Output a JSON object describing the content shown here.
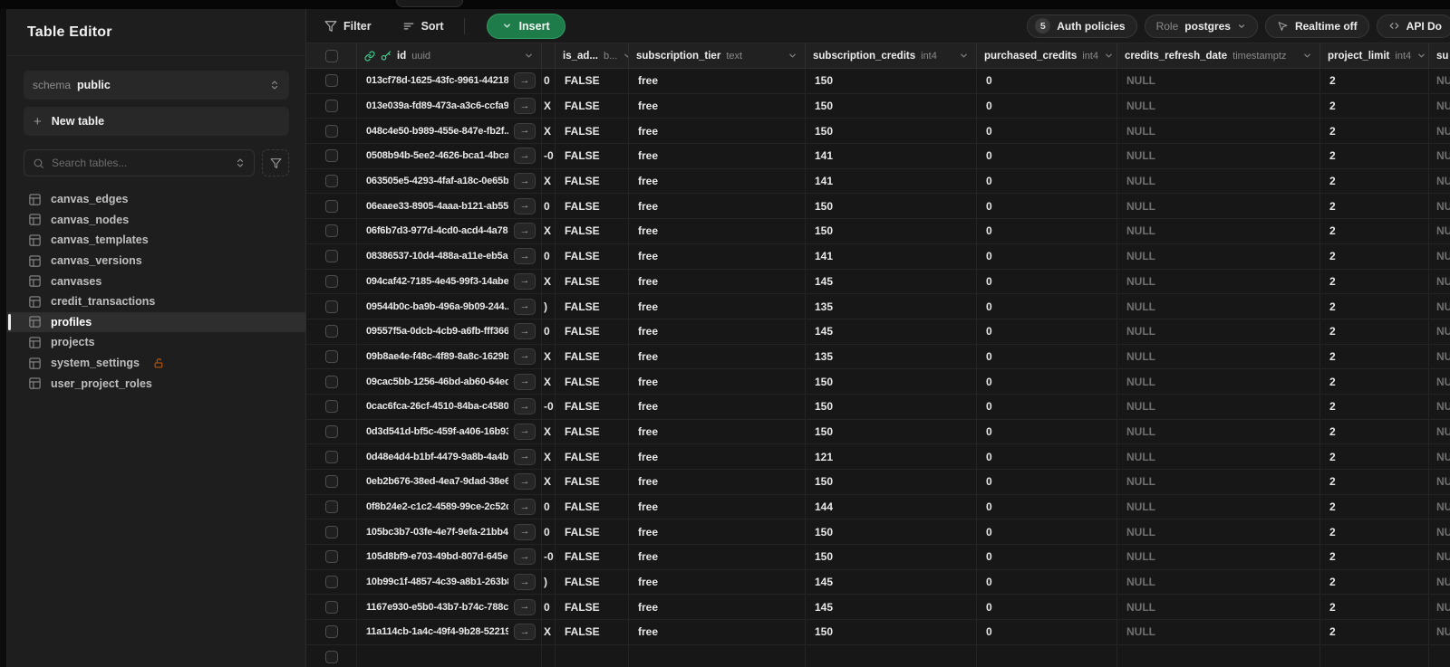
{
  "palette": {
    "accent_green": "#3ecf8e",
    "insert_button_green": "#1d7c4a",
    "lock_amber": "#b45309",
    "null_text_gray": "#707070"
  },
  "sidebar": {
    "title": "Table Editor",
    "schema_label": "schema",
    "schema_value": "public",
    "new_table_label": "New table",
    "search_placeholder": "Search tables...",
    "tables": [
      {
        "label": "canvas_edges",
        "selected": false,
        "locked": false
      },
      {
        "label": "canvas_nodes",
        "selected": false,
        "locked": false
      },
      {
        "label": "canvas_templates",
        "selected": false,
        "locked": false
      },
      {
        "label": "canvas_versions",
        "selected": false,
        "locked": false
      },
      {
        "label": "canvases",
        "selected": false,
        "locked": false
      },
      {
        "label": "credit_transactions",
        "selected": false,
        "locked": false
      },
      {
        "label": "profiles",
        "selected": true,
        "locked": false
      },
      {
        "label": "projects",
        "selected": false,
        "locked": false
      },
      {
        "label": "system_settings",
        "selected": false,
        "locked": true
      },
      {
        "label": "user_project_roles",
        "selected": false,
        "locked": false
      }
    ]
  },
  "toolbar": {
    "filter_label": "Filter",
    "sort_label": "Sort",
    "insert_label": "Insert",
    "auth_policies_count": "5",
    "auth_policies_label": "Auth policies",
    "role_prefix": "Role",
    "role_value": "postgres",
    "realtime_label": "Realtime off",
    "api_docs_label": "API Do"
  },
  "grid": {
    "columns": [
      {
        "name": "id",
        "type": "uuid"
      },
      {
        "name": "",
        "type": ""
      },
      {
        "name": "is_ad...",
        "type": "b..."
      },
      {
        "name": "subscription_tier",
        "type": "text"
      },
      {
        "name": "subscription_credits",
        "type": "int4"
      },
      {
        "name": "purchased_credits",
        "type": "int4"
      },
      {
        "name": "credits_refresh_date",
        "type": "timestamptz"
      },
      {
        "name": "project_limit",
        "type": "int4"
      },
      {
        "name": "su",
        "type": ""
      }
    ],
    "expand_glyph": "→",
    "rows": [
      {
        "id": "013cf78d-1625-43fc-9961-442189...",
        "frag": "0",
        "is_admin": "FALSE",
        "tier": "free",
        "sub_credits": "150",
        "purchased": "0",
        "refresh": "NULL",
        "limit": "2",
        "last": "NULL"
      },
      {
        "id": "013e039a-fd89-473a-a3c6-ccfa9...",
        "frag": "X",
        "is_admin": "FALSE",
        "tier": "free",
        "sub_credits": "150",
        "purchased": "0",
        "refresh": "NULL",
        "limit": "2",
        "last": "NULL"
      },
      {
        "id": "048c4e50-b989-455e-847e-fb2f...",
        "frag": "X",
        "is_admin": "FALSE",
        "tier": "free",
        "sub_credits": "150",
        "purchased": "0",
        "refresh": "NULL",
        "limit": "2",
        "last": "NULL"
      },
      {
        "id": "0508b94b-5ee2-4626-bca1-4bca...",
        "frag": "-0",
        "is_admin": "FALSE",
        "tier": "free",
        "sub_credits": "141",
        "purchased": "0",
        "refresh": "NULL",
        "limit": "2",
        "last": "NULL"
      },
      {
        "id": "063505e5-4293-4faf-a18c-0e65b...",
        "frag": "X",
        "is_admin": "FALSE",
        "tier": "free",
        "sub_credits": "141",
        "purchased": "0",
        "refresh": "NULL",
        "limit": "2",
        "last": "NULL"
      },
      {
        "id": "06eaee33-8905-4aaa-b121-ab552...",
        "frag": "0",
        "is_admin": "FALSE",
        "tier": "free",
        "sub_credits": "150",
        "purchased": "0",
        "refresh": "NULL",
        "limit": "2",
        "last": "NULL"
      },
      {
        "id": "06f6b7d3-977d-4cd0-acd4-4a78...",
        "frag": "X",
        "is_admin": "FALSE",
        "tier": "free",
        "sub_credits": "150",
        "purchased": "0",
        "refresh": "NULL",
        "limit": "2",
        "last": "NULL"
      },
      {
        "id": "08386537-10d4-488a-a11e-eb5a6...",
        "frag": "0",
        "is_admin": "FALSE",
        "tier": "free",
        "sub_credits": "141",
        "purchased": "0",
        "refresh": "NULL",
        "limit": "2",
        "last": "NULL"
      },
      {
        "id": "094caf42-7185-4e45-99f3-14abee...",
        "frag": "X",
        "is_admin": "FALSE",
        "tier": "free",
        "sub_credits": "145",
        "purchased": "0",
        "refresh": "NULL",
        "limit": "2",
        "last": "NULL"
      },
      {
        "id": "09544b0c-ba9b-496a-9b09-244...",
        "frag": ")",
        "is_admin": "FALSE",
        "tier": "free",
        "sub_credits": "135",
        "purchased": "0",
        "refresh": "NULL",
        "limit": "2",
        "last": "NULL"
      },
      {
        "id": "09557f5a-0dcb-4cb9-a6fb-fff366...",
        "frag": "0",
        "is_admin": "FALSE",
        "tier": "free",
        "sub_credits": "145",
        "purchased": "0",
        "refresh": "NULL",
        "limit": "2",
        "last": "NULL"
      },
      {
        "id": "09b8ae4e-f48c-4f89-8a8c-1629b...",
        "frag": "X",
        "is_admin": "FALSE",
        "tier": "free",
        "sub_credits": "135",
        "purchased": "0",
        "refresh": "NULL",
        "limit": "2",
        "last": "NULL"
      },
      {
        "id": "09cac5bb-1256-46bd-ab60-64ed...",
        "frag": "X",
        "is_admin": "FALSE",
        "tier": "free",
        "sub_credits": "150",
        "purchased": "0",
        "refresh": "NULL",
        "limit": "2",
        "last": "NULL"
      },
      {
        "id": "0cac6fca-26cf-4510-84ba-c4580...",
        "frag": "-0",
        "is_admin": "FALSE",
        "tier": "free",
        "sub_credits": "150",
        "purchased": "0",
        "refresh": "NULL",
        "limit": "2",
        "last": "NULL"
      },
      {
        "id": "0d3d541d-bf5c-459f-a406-16b93...",
        "frag": "X",
        "is_admin": "FALSE",
        "tier": "free",
        "sub_credits": "150",
        "purchased": "0",
        "refresh": "NULL",
        "limit": "2",
        "last": "NULL"
      },
      {
        "id": "0d48e4d4-b1bf-4479-9a8b-4a4b...",
        "frag": "X",
        "is_admin": "FALSE",
        "tier": "free",
        "sub_credits": "121",
        "purchased": "0",
        "refresh": "NULL",
        "limit": "2",
        "last": "NULL"
      },
      {
        "id": "0eb2b676-38ed-4ea7-9dad-38e6...",
        "frag": "X",
        "is_admin": "FALSE",
        "tier": "free",
        "sub_credits": "150",
        "purchased": "0",
        "refresh": "NULL",
        "limit": "2",
        "last": "NULL"
      },
      {
        "id": "0f8b24e2-c1c2-4589-99ce-2c52d...",
        "frag": "0",
        "is_admin": "FALSE",
        "tier": "free",
        "sub_credits": "144",
        "purchased": "0",
        "refresh": "NULL",
        "limit": "2",
        "last": "NULL"
      },
      {
        "id": "105bc3b7-03fe-4e7f-9efa-21bb40...",
        "frag": "0",
        "is_admin": "FALSE",
        "tier": "free",
        "sub_credits": "150",
        "purchased": "0",
        "refresh": "NULL",
        "limit": "2",
        "last": "NULL"
      },
      {
        "id": "105d8bf9-e703-49bd-807d-645e...",
        "frag": "-0",
        "is_admin": "FALSE",
        "tier": "free",
        "sub_credits": "150",
        "purchased": "0",
        "refresh": "NULL",
        "limit": "2",
        "last": "NULL"
      },
      {
        "id": "10b99c1f-4857-4c39-a8b1-263b8...",
        "frag": ")",
        "is_admin": "FALSE",
        "tier": "free",
        "sub_credits": "145",
        "purchased": "0",
        "refresh": "NULL",
        "limit": "2",
        "last": "NULL"
      },
      {
        "id": "1167e930-e5b0-43b7-b74c-788c9...",
        "frag": "0",
        "is_admin": "FALSE",
        "tier": "free",
        "sub_credits": "145",
        "purchased": "0",
        "refresh": "NULL",
        "limit": "2",
        "last": "NULL"
      },
      {
        "id": "11a114cb-1a4c-49f4-9b28-52219ec...",
        "frag": "X",
        "is_admin": "FALSE",
        "tier": "free",
        "sub_credits": "150",
        "purchased": "0",
        "refresh": "NULL",
        "limit": "2",
        "last": "NULL"
      }
    ]
  }
}
